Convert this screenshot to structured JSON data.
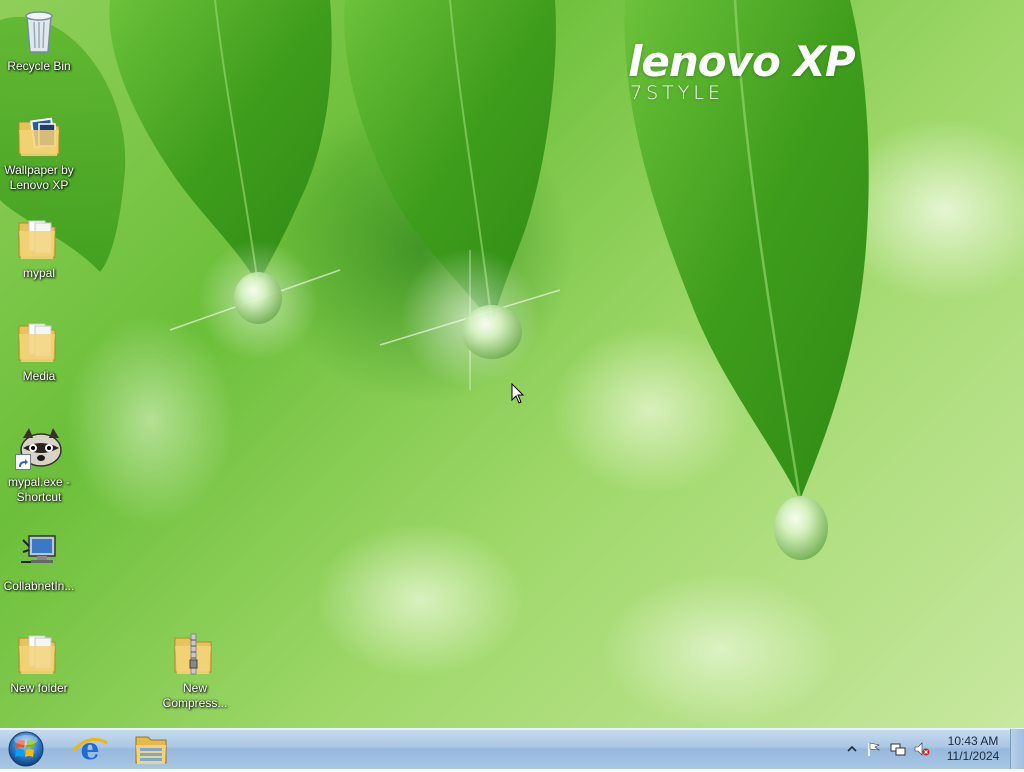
{
  "wallpaper": {
    "brand_main": "lenovo XP",
    "brand_sub": "7STYLE"
  },
  "desktop_icons": [
    {
      "label": "Recycle Bin",
      "icon": "recycle-bin-icon"
    },
    {
      "label": "Wallpaper by Lenovo XP",
      "icon": "folder-icon"
    },
    {
      "label": "mypal",
      "icon": "folder-icon"
    },
    {
      "label": "Media",
      "icon": "folder-icon"
    },
    {
      "label": "mypal.exe - Shortcut",
      "icon": "raccoon-app-icon"
    },
    {
      "label": "CollabnetIn...",
      "icon": "network-computer-icon"
    },
    {
      "label": "New folder",
      "icon": "folder-icon"
    },
    {
      "label": "New Compress...",
      "icon": "zip-folder-icon"
    }
  ],
  "taskbar": {
    "start_icon": "windows-orb-icon",
    "pinned": [
      {
        "name": "Internet Explorer",
        "icon": "internet-explorer-icon"
      },
      {
        "name": "Windows Explorer",
        "icon": "file-explorer-icon"
      }
    ],
    "tray": {
      "icons": [
        "show-hidden-icons-icon",
        "action-center-flag-icon",
        "network-icon",
        "volume-muted-icon"
      ],
      "time": "10:43 AM",
      "date": "11/1/2024"
    }
  },
  "colors": {
    "taskbar": "#a9c6e4",
    "leaf_green": "#4fae22",
    "background_green": "#8fcf5a"
  }
}
